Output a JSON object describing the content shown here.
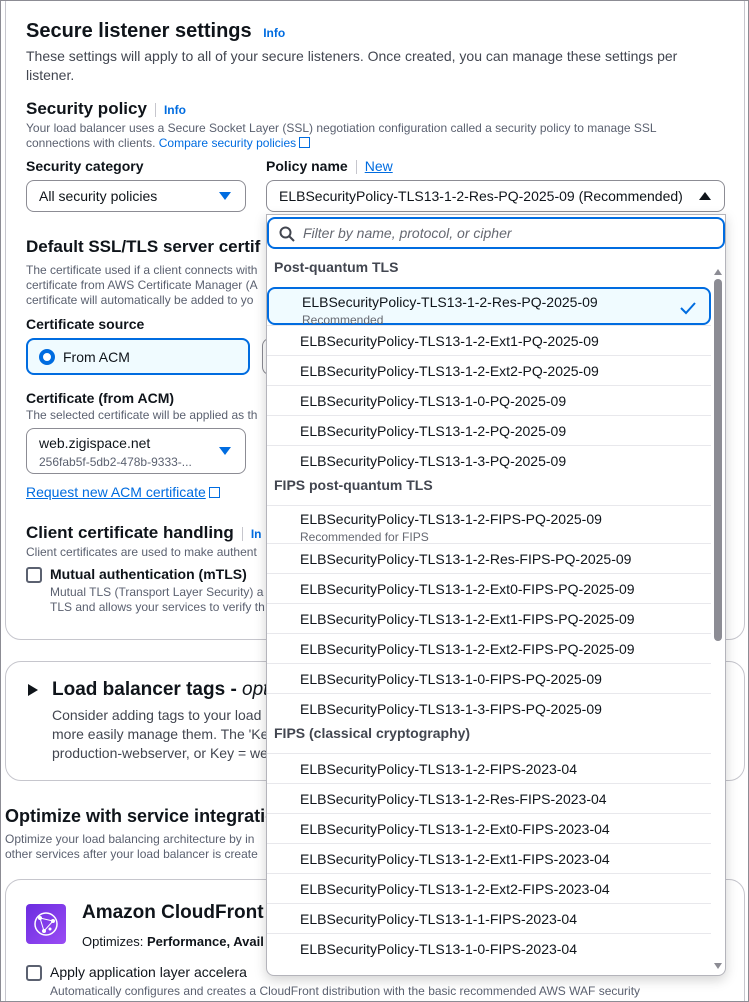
{
  "secure_listener": {
    "title": "Secure listener settings",
    "info": "Info",
    "desc_line1": "These settings will apply to all of your secure listeners. Once created, you can manage these settings per",
    "desc_line2": "listener."
  },
  "security_policy": {
    "title": "Security policy",
    "info": "Info",
    "desc_line1": "Your load balancer uses a Secure Socket Layer (SSL) negotiation configuration called a security policy to manage SSL",
    "desc_line2_prefix": "connections with clients.",
    "compare_link": "Compare security policies",
    "category_label": "Security category",
    "category_value": "All security policies",
    "policy_label": "Policy name",
    "new_link": "New",
    "policy_value": "ELBSecurityPolicy-TLS13-1-2-Res-PQ-2025-09 (Recommended)"
  },
  "default_cert": {
    "title": "Default SSL/TLS server certif",
    "desc_line1": "The certificate used if a client connects with",
    "desc_line2": "certificate from AWS Certificate Manager (A",
    "desc_line3": "certificate will automatically be added to yo",
    "source_label": "Certificate source",
    "source_option": "From ACM",
    "cert_label": "Certificate (from ACM)",
    "cert_desc": "The selected certificate will be applied as th",
    "cert_value": "web.zigispace.net",
    "cert_id": "256fab5f-5db2-478b-9333-...",
    "request_link": "Request new ACM certificate"
  },
  "client_cert": {
    "title": "Client certificate handling",
    "info_partial": "In",
    "desc": "Client certificates are used to make authent",
    "mtls_label": "Mutual authentication (mTLS)",
    "mtls_desc1": "Mutual TLS (Transport Layer Security) a",
    "mtls_desc2": "TLS and allows your services to verify th"
  },
  "tags": {
    "title": "Load balancer tags - ",
    "title_optional": "opt",
    "desc1": "Consider adding tags to your load",
    "desc2": "more easily manage them. The 'Ke",
    "desc3": "production-webserver, or Key = we"
  },
  "optimize": {
    "title": "Optimize with service integratio",
    "desc1": "Optimize your load balancing architecture by in",
    "desc2": "other services after your load balancer is create"
  },
  "cloudfront": {
    "title": "Amazon CloudFront",
    "optimizes_prefix": "Optimizes: ",
    "optimizes_value": "Performance, Avail",
    "apply_label": "Apply application layer accelera",
    "apply_desc": "Automatically configures and creates a CloudFront distribution with the basic recommended AWS WAF security"
  },
  "dropdown": {
    "filter_placeholder": "Filter by name, protocol, or cipher",
    "groups": [
      {
        "label": "Post-quantum TLS",
        "options": [
          {
            "name": "ELBSecurityPolicy-TLS13-1-2-Res-PQ-2025-09",
            "sub": "Recommended",
            "selected": true
          },
          {
            "name": "ELBSecurityPolicy-TLS13-1-2-Ext1-PQ-2025-09"
          },
          {
            "name": "ELBSecurityPolicy-TLS13-1-2-Ext2-PQ-2025-09"
          },
          {
            "name": "ELBSecurityPolicy-TLS13-1-0-PQ-2025-09"
          },
          {
            "name": "ELBSecurityPolicy-TLS13-1-2-PQ-2025-09"
          },
          {
            "name": "ELBSecurityPolicy-TLS13-1-3-PQ-2025-09"
          }
        ]
      },
      {
        "label": "FIPS post-quantum TLS",
        "options": [
          {
            "name": "ELBSecurityPolicy-TLS13-1-2-FIPS-PQ-2025-09",
            "sub": "Recommended for FIPS"
          },
          {
            "name": "ELBSecurityPolicy-TLS13-1-2-Res-FIPS-PQ-2025-09"
          },
          {
            "name": "ELBSecurityPolicy-TLS13-1-2-Ext0-FIPS-PQ-2025-09"
          },
          {
            "name": "ELBSecurityPolicy-TLS13-1-2-Ext1-FIPS-PQ-2025-09"
          },
          {
            "name": "ELBSecurityPolicy-TLS13-1-2-Ext2-FIPS-PQ-2025-09"
          },
          {
            "name": "ELBSecurityPolicy-TLS13-1-0-FIPS-PQ-2025-09"
          },
          {
            "name": "ELBSecurityPolicy-TLS13-1-3-FIPS-PQ-2025-09"
          }
        ]
      },
      {
        "label": "FIPS (classical cryptography)",
        "options": [
          {
            "name": "ELBSecurityPolicy-TLS13-1-2-FIPS-2023-04"
          },
          {
            "name": "ELBSecurityPolicy-TLS13-1-2-Res-FIPS-2023-04"
          },
          {
            "name": "ELBSecurityPolicy-TLS13-1-2-Ext0-FIPS-2023-04"
          },
          {
            "name": "ELBSecurityPolicy-TLS13-1-2-Ext1-FIPS-2023-04"
          },
          {
            "name": "ELBSecurityPolicy-TLS13-1-2-Ext2-FIPS-2023-04"
          },
          {
            "name": "ELBSecurityPolicy-TLS13-1-1-FIPS-2023-04"
          },
          {
            "name": "ELBSecurityPolicy-TLS13-1-0-FIPS-2023-04"
          }
        ]
      }
    ]
  },
  "colors": {
    "accent": "#006ce0",
    "selected_bg": "#f0fbff",
    "border": "#c6c6cd",
    "text_secondary": "#656871"
  }
}
